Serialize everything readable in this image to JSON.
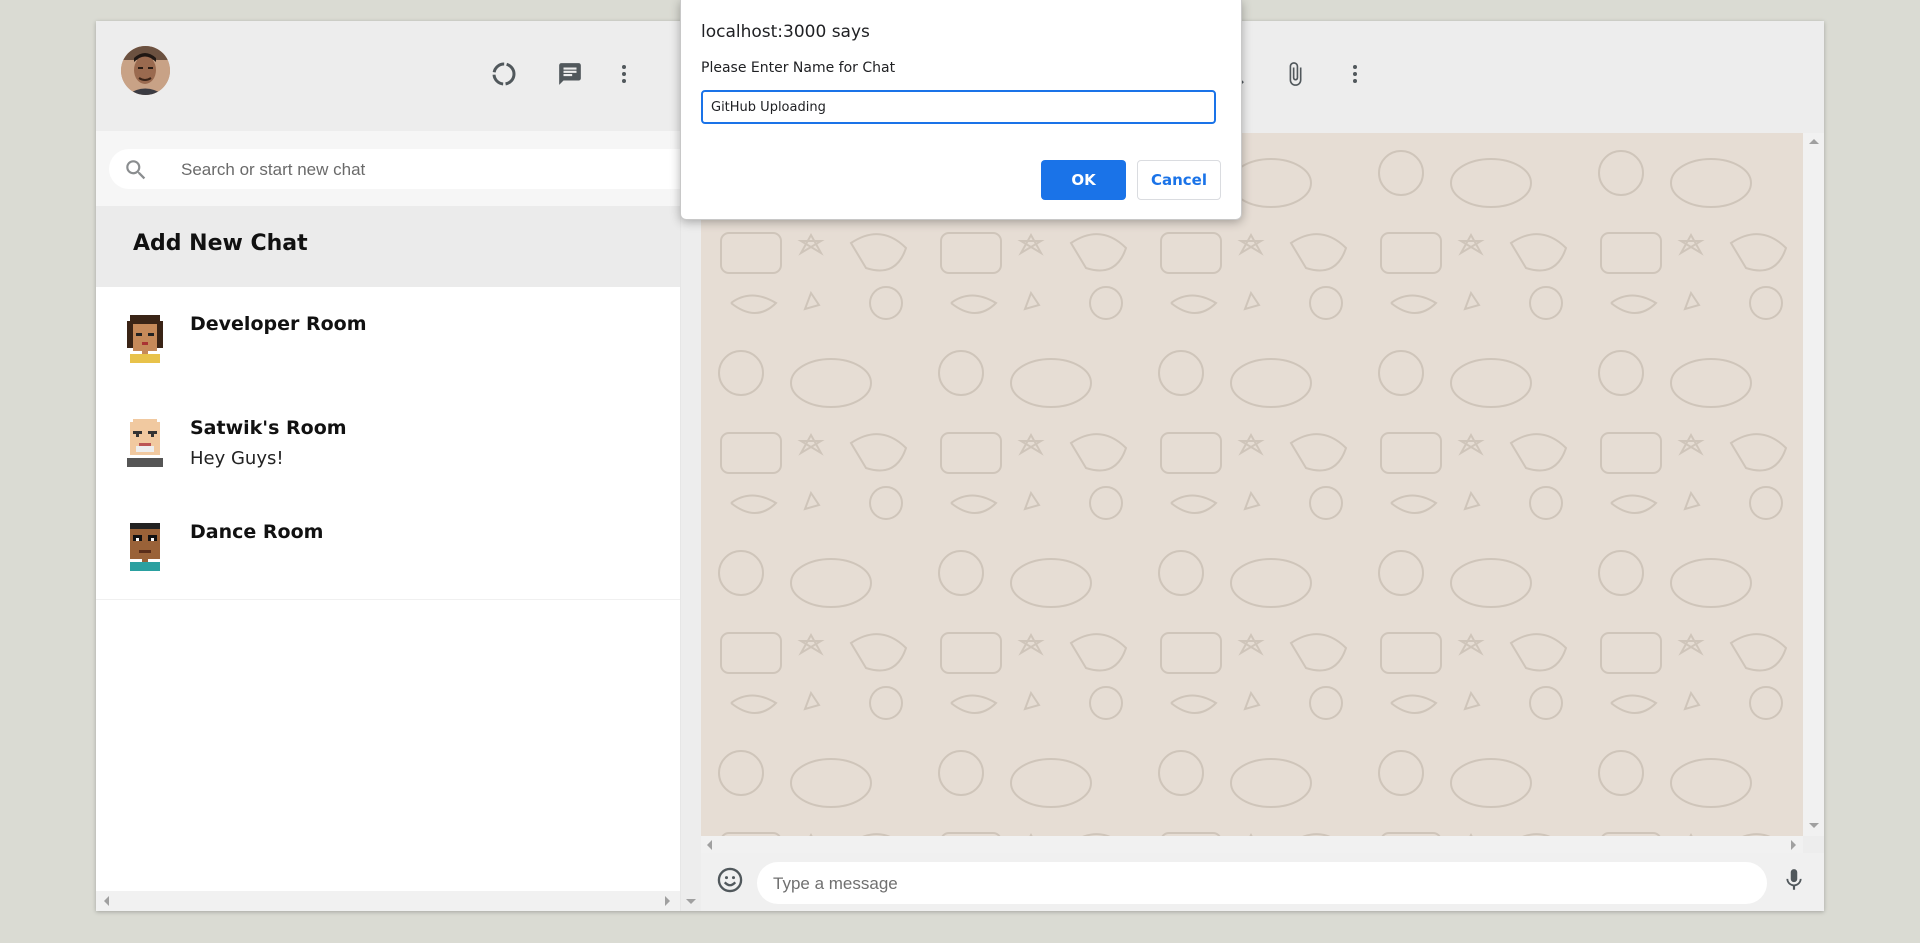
{
  "search": {
    "placeholder": "Search or start new chat"
  },
  "sidebar": {
    "add_chat_label": "Add New Chat",
    "rooms": [
      {
        "name": "Developer Room",
        "last_message": ""
      },
      {
        "name": "Satwik's Room",
        "last_message": "Hey Guys!"
      },
      {
        "name": "Dance Room",
        "last_message": ""
      }
    ]
  },
  "composer": {
    "placeholder": "Type a message"
  },
  "dialog": {
    "title": "localhost:3000 says",
    "message": "Please Enter Name for Chat",
    "input_value": "GitHub Uploading",
    "ok_label": "OK",
    "cancel_label": "Cancel"
  },
  "icons": {
    "header_left": [
      "status-icon",
      "chat-icon",
      "more-vert-icon"
    ],
    "header_right": [
      "search-icon",
      "attach-icon",
      "more-vert-icon"
    ],
    "composer": [
      "emoji-icon",
      "mic-icon"
    ]
  },
  "colors": {
    "accent": "#1a73e8",
    "chat_background": "#e6ddd4",
    "header_background": "#ededed",
    "page_background": "#dadbd3"
  }
}
